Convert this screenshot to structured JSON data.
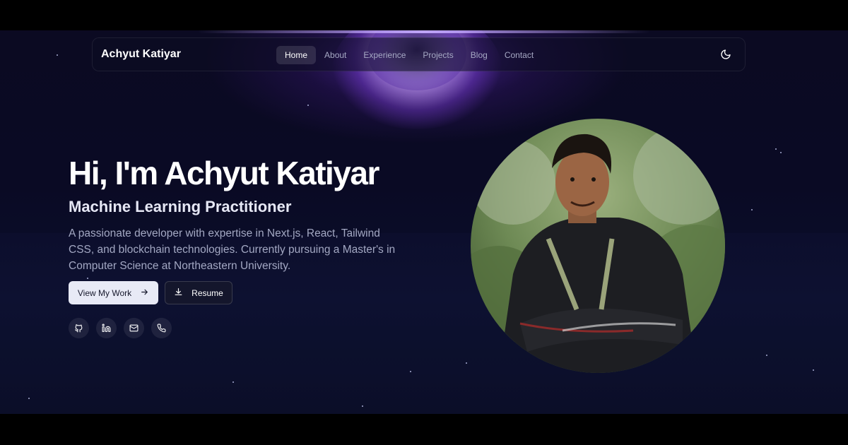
{
  "nav": {
    "brand": "Achyut Katiyar",
    "links": [
      {
        "label": "Home",
        "active": true
      },
      {
        "label": "About",
        "active": false
      },
      {
        "label": "Experience",
        "active": false
      },
      {
        "label": "Projects",
        "active": false
      },
      {
        "label": "Blog",
        "active": false
      },
      {
        "label": "Contact",
        "active": false
      }
    ],
    "theme_toggle_icon": "moon-icon"
  },
  "hero": {
    "title": "Hi, I'm Achyut Katiyar",
    "subtitle": "Machine Learning Practitioner",
    "description": "A passionate developer with expertise in Next.js, React, Tailwind CSS, and blockchain technologies. Currently pursuing a Master's in Computer Science at Northeastern University.",
    "primary_button": {
      "label": "View My Work",
      "icon": "arrow-right-icon"
    },
    "secondary_button": {
      "label": "Resume",
      "icon": "download-icon"
    },
    "socials": [
      {
        "icon": "github-icon"
      },
      {
        "icon": "linkedin-icon"
      },
      {
        "icon": "mail-icon"
      },
      {
        "icon": "phone-icon"
      }
    ]
  },
  "colors": {
    "background": "#0a0a24",
    "accent_glow": "#7c3aed",
    "primary_button_bg": "#e8eaf6",
    "muted_text": "#a3a8c3"
  }
}
